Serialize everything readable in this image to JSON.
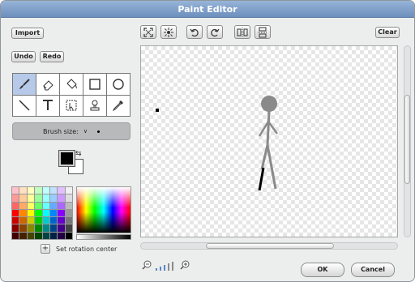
{
  "window": {
    "title": "Paint Editor"
  },
  "left_buttons": {
    "import": "Import",
    "undo": "Undo",
    "redo": "Redo"
  },
  "toolbar": {
    "icons": [
      "zoom-fit-icon",
      "grow-icon",
      "rotate-left-icon",
      "rotate-right-icon",
      "flip-horizontal-icon",
      "flip-vertical-icon"
    ],
    "clear": "Clear"
  },
  "tools": [
    {
      "name": "paintbrush-icon",
      "selected": true
    },
    {
      "name": "eraser-icon",
      "selected": false
    },
    {
      "name": "fill-bucket-icon",
      "selected": false
    },
    {
      "name": "rectangle-icon",
      "selected": false
    },
    {
      "name": "ellipse-icon",
      "selected": false
    },
    {
      "name": "line-icon",
      "selected": false
    },
    {
      "name": "text-icon",
      "selected": false
    },
    {
      "name": "select-icon",
      "selected": false
    },
    {
      "name": "stamp-icon",
      "selected": false
    },
    {
      "name": "eyedropper-icon",
      "selected": false
    }
  ],
  "brush": {
    "label": "Brush size:"
  },
  "colors": {
    "foreground": "#000000",
    "background": "#ffffff",
    "palette": [
      "#ffc0cb",
      "#ffe0c0",
      "#ffffc0",
      "#c0ffc0",
      "#c0ffff",
      "#c0e0ff",
      "#e0c0ff",
      "#f0f0f0",
      "#ff9999",
      "#ffcc99",
      "#ffff99",
      "#99ff99",
      "#99ffff",
      "#99ccff",
      "#cc99ff",
      "#dddddd",
      "#ff6666",
      "#ffaa66",
      "#ffff66",
      "#66ff66",
      "#66ffff",
      "#66aaff",
      "#aa66ff",
      "#bbbbbb",
      "#ff0000",
      "#ff8800",
      "#ffff00",
      "#00ff00",
      "#00ffff",
      "#0088ff",
      "#8800ff",
      "#999999",
      "#cc0000",
      "#cc6600",
      "#cccc00",
      "#00cc00",
      "#00cccc",
      "#0066cc",
      "#6600cc",
      "#777777",
      "#880000",
      "#884400",
      "#888800",
      "#008800",
      "#008888",
      "#004488",
      "#440088",
      "#444444",
      "#440000",
      "#442200",
      "#444400",
      "#004400",
      "#004444",
      "#002244",
      "#220044",
      "#000000"
    ]
  },
  "rotation": {
    "label": "Set rotation center"
  },
  "zoom": {
    "out": "zoom-out-icon",
    "in": "zoom-in-icon"
  },
  "footer": {
    "ok": "OK",
    "cancel": "Cancel"
  }
}
